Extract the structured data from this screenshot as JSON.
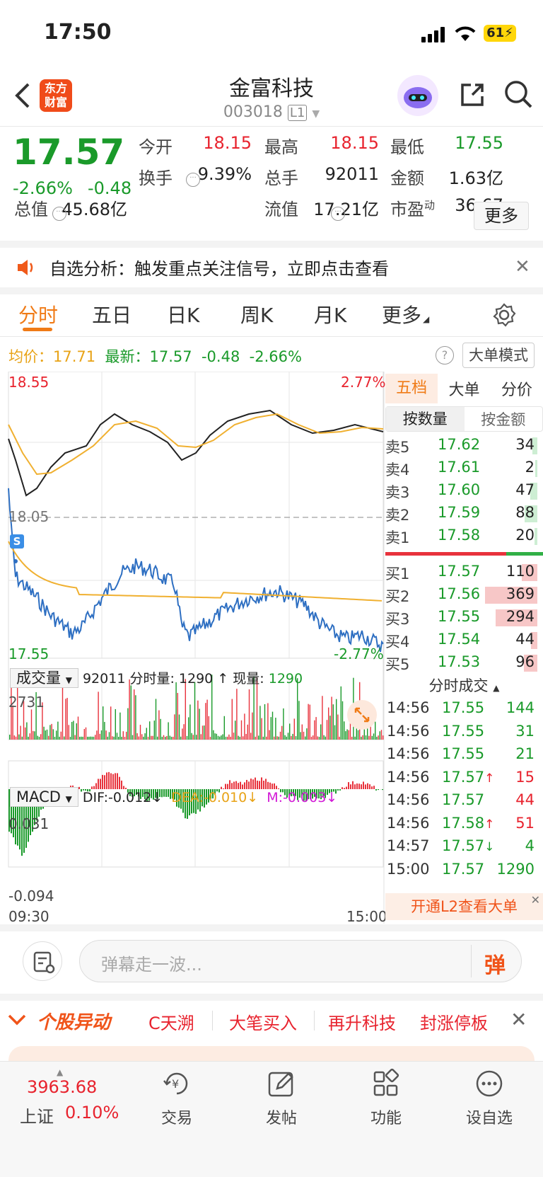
{
  "status_bar": {
    "time": "17:50",
    "battery": "61"
  },
  "header": {
    "title": "金富科技",
    "code": "003018",
    "level": "L1",
    "logo_line1": "东方",
    "logo_line2": "财富"
  },
  "quote": {
    "price": "17.57",
    "pct": "-2.66%",
    "change": "-0.48",
    "fields": [
      {
        "label": "今开",
        "value": "18.15",
        "color": "up"
      },
      {
        "label": "最高",
        "value": "18.15",
        "color": "up"
      },
      {
        "label": "最低",
        "value": "17.55",
        "color": "dn"
      },
      {
        "label": "换手",
        "value": "9.39%",
        "color": ""
      },
      {
        "label": "总手",
        "value": "92011",
        "color": ""
      },
      {
        "label": "金额",
        "value": "1.63亿",
        "color": ""
      },
      {
        "label": "总值",
        "value": "45.68亿",
        "color": ""
      },
      {
        "label": "流值",
        "value": "17.21亿",
        "color": ""
      },
      {
        "label": "市盈",
        "sup": "动",
        "value": "36.67",
        "color": ""
      }
    ],
    "more": "更多"
  },
  "notice": {
    "text": "自选分析：触发重点关注信号，立即点击查看"
  },
  "tabs": [
    "分时",
    "五日",
    "日K",
    "周K",
    "月K",
    "更多"
  ],
  "info_line": {
    "avg_label": "均价：",
    "avg": "17.71",
    "latest_label": "最新：",
    "latest": "17.57",
    "chg": "-0.48",
    "pct": "-2.66%",
    "mode_btn": "大单模式"
  },
  "chart_labels": {
    "top": "18.55",
    "top_pct": "2.77%",
    "mid": "18.05",
    "bottom": "17.55",
    "bottom_pct": "-2.77%",
    "marker": "S"
  },
  "volume": {
    "selector": "成交量",
    "total": "92011",
    "seg_label": "分时量:",
    "seg_value": "1290",
    "now_label": "现量:",
    "now_value": "1290",
    "max": "2731",
    "arrow": "↑"
  },
  "macd": {
    "selector": "MACD",
    "dif": "DIF:-0.012",
    "dea": "DEA:-0.010",
    "m": "M:-0.003",
    "top": "0.031",
    "bottom": "-0.094",
    "arrow": "↓"
  },
  "time_axis": {
    "start": "09:30",
    "end": "15:00"
  },
  "order_book": {
    "tabs": [
      "五档",
      "大单",
      "分价"
    ],
    "subtabs": [
      "按数量",
      "按金额"
    ],
    "sells": [
      {
        "label": "卖5",
        "price": "17.62",
        "vol": "34",
        "bar": 0.09
      },
      {
        "label": "卖4",
        "price": "17.61",
        "vol": "2",
        "bar": 0.01
      },
      {
        "label": "卖3",
        "price": "17.60",
        "vol": "47",
        "bar": 0.13
      },
      {
        "label": "卖2",
        "price": "17.59",
        "vol": "88",
        "bar": 0.24
      },
      {
        "label": "卖1",
        "price": "17.58",
        "vol": "20",
        "bar": 0.05
      }
    ],
    "buys": [
      {
        "label": "买1",
        "price": "17.57",
        "vol": "110",
        "bar": 0.3
      },
      {
        "label": "买2",
        "price": "17.56",
        "vol": "369",
        "bar": 1.0
      },
      {
        "label": "买3",
        "price": "17.55",
        "vol": "294",
        "bar": 0.8
      },
      {
        "label": "买4",
        "price": "17.54",
        "vol": "44",
        "bar": 0.12
      },
      {
        "label": "买5",
        "price": "17.53",
        "vol": "96",
        "bar": 0.26
      }
    ]
  },
  "trades": {
    "title": "分时成交",
    "rows": [
      {
        "t": "14:56",
        "p": "17.55",
        "v": "144",
        "pc": "dn",
        "vc": "dn",
        "a": ""
      },
      {
        "t": "14:56",
        "p": "17.55",
        "v": "31",
        "pc": "dn",
        "vc": "dn",
        "a": ""
      },
      {
        "t": "14:56",
        "p": "17.55",
        "v": "21",
        "pc": "dn",
        "vc": "dn",
        "a": ""
      },
      {
        "t": "14:56",
        "p": "17.57",
        "v": "15",
        "pc": "dn",
        "vc": "up",
        "a": "↑"
      },
      {
        "t": "14:56",
        "p": "17.57",
        "v": "44",
        "pc": "dn",
        "vc": "up",
        "a": ""
      },
      {
        "t": "14:56",
        "p": "17.58",
        "v": "51",
        "pc": "dn",
        "vc": "up",
        "a": "↑"
      },
      {
        "t": "14:57",
        "p": "17.57",
        "v": "4",
        "pc": "dn",
        "vc": "dn",
        "a": "↓"
      },
      {
        "t": "15:00",
        "p": "17.57",
        "v": "1290",
        "pc": "dn",
        "vc": "dn",
        "a": ""
      }
    ],
    "l2_promo": "开通L2查看大单"
  },
  "comment": {
    "placeholder": "弹幕走一波...",
    "btn": "弹"
  },
  "movers": {
    "title": "个股异动",
    "items": [
      "C天溯",
      "大笔买入",
      "再升科技",
      "封涨停板"
    ]
  },
  "bottom_nav": {
    "index_value": "3963.68",
    "index_name": "上证",
    "index_pct": "0.10%",
    "items": [
      "交易",
      "发帖",
      "功能",
      "设自选"
    ]
  },
  "colors": {
    "up": "#e8232e",
    "down": "#1a9a2a",
    "avg": "#f0b030",
    "accent": "#f07b17"
  }
}
